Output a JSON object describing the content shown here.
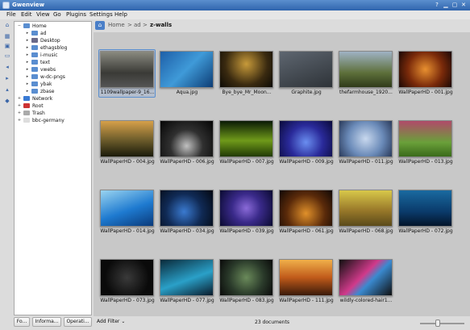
{
  "window": {
    "title": "Gwenview",
    "buttons": [
      "?",
      "▁",
      "▢",
      "✕"
    ]
  },
  "menu": [
    "File",
    "Edit",
    "View",
    "Go",
    "Plugins",
    "Settings",
    "Help"
  ],
  "sidebar_tools": [
    "home-icon",
    "grid-icon",
    "image-icon",
    "folder-icon",
    "back-icon",
    "forward-icon",
    "up-icon",
    "tag-icon"
  ],
  "tree": [
    {
      "label": "Home",
      "depth": 0,
      "expander": "−",
      "icon": "#5a8ed0"
    },
    {
      "label": "ad",
      "depth": 1,
      "expander": "▸",
      "icon": "#5a8ed0"
    },
    {
      "label": "Desktop",
      "depth": 1,
      "expander": "▸",
      "icon": "#6a6a8a"
    },
    {
      "label": "ethagsblog",
      "depth": 1,
      "expander": "▸",
      "icon": "#5a8ed0"
    },
    {
      "label": "i-music",
      "depth": 1,
      "expander": "▸",
      "icon": "#5a8ed0"
    },
    {
      "label": "text",
      "depth": 1,
      "expander": "▸",
      "icon": "#5a8ed0"
    },
    {
      "label": "vwebs",
      "depth": 1,
      "expander": "▸",
      "icon": "#5a8ed0"
    },
    {
      "label": "w-dc-pngs",
      "depth": 1,
      "expander": "▸",
      "icon": "#5a8ed0"
    },
    {
      "label": "ybak",
      "depth": 1,
      "expander": "▸",
      "icon": "#5a8ed0"
    },
    {
      "label": "zbase",
      "depth": 1,
      "expander": "▸",
      "icon": "#5a8ed0"
    },
    {
      "label": "Network",
      "depth": 0,
      "expander": "+",
      "icon": "#3a7bd5"
    },
    {
      "label": "Root",
      "depth": 0,
      "expander": "+",
      "icon": "#c33"
    },
    {
      "label": "Trash",
      "depth": 0,
      "expander": "+",
      "icon": "#aaa"
    },
    {
      "label": "bbc-germany",
      "depth": 0,
      "expander": "+",
      "icon": "#ddd"
    }
  ],
  "panel_buttons": [
    "Fo...",
    "Informa...",
    "Operati..."
  ],
  "breadcrumb": {
    "home_icon": "⌂",
    "parts": [
      "Home",
      ">",
      "ad",
      ">",
      "z-walls"
    ]
  },
  "thumbnails": [
    {
      "name": "1109wallpaper-9_16...",
      "g": "linear-gradient(180deg,#8a8a80,#3a3a36 60%,#555)",
      "selected": true
    },
    {
      "name": "Aqua.jpg",
      "g": "linear-gradient(135deg,#1e5fa8,#3f9ad8 50%,#0d3d75)"
    },
    {
      "name": "Bye_bye_Mr_Moon...",
      "g": "radial-gradient(circle at 50% 35%,#c79a3a,#3a2a10 60%,#0c0a05)"
    },
    {
      "name": "Graphite.jpg",
      "g": "linear-gradient(160deg,#5e6670,#2e3338)"
    },
    {
      "name": "thefarmhouse_1920...",
      "g": "linear-gradient(180deg,#9fb2c4,#5d6f3a 60%,#2f3a1a)"
    },
    {
      "name": "WallPaperHD - 001.jpg",
      "g": "radial-gradient(circle,#e89030,#7a2a0a 55%,#1a0805)"
    },
    {
      "name": "WallPaperHD - 004.jpg",
      "g": "linear-gradient(180deg,#d7a04a,#6a5a2a 55%,#1a1a0a)"
    },
    {
      "name": "WallPaperHD - 006.jpg",
      "g": "radial-gradient(circle at 50% 70%,#c0c0c0,#303030 45%,#050505)"
    },
    {
      "name": "WallPaperHD - 007.jpg",
      "g": "linear-gradient(180deg,#0a1a05,#6f9a1a 55%,#213a05)"
    },
    {
      "name": "WallPaperHD - 009.jpg",
      "g": "radial-gradient(circle at 50% 60%,#6a8ef0,#2a2a9a 50%,#0a0a3a)"
    },
    {
      "name": "WallPaperHD - 011.jpg",
      "g": "radial-gradient(circle,#c8d8ee,#6a8ab8 55%,#2a3a5a)"
    },
    {
      "name": "WallPaperHD - 013.jpg",
      "g": "linear-gradient(180deg,#b04a6a,#6aa03a 60%,#3a6a1a)"
    },
    {
      "name": "WallPaperHD - 014.jpg",
      "g": "linear-gradient(160deg,#9ad4f0,#1e7ad0 55%,#0a3a7a)"
    },
    {
      "name": "WallPaperHD - 034.jpg",
      "g": "radial-gradient(circle at 45% 60%,#3a7ad0,#102a55 50%,#030810)"
    },
    {
      "name": "WallPaperHD - 039.jpg",
      "g": "radial-gradient(circle,#8a6ad8,#3a2a8a 45%,#0a0a30)"
    },
    {
      "name": "WallPaperHD - 061.jpg",
      "g": "radial-gradient(circle at 50% 65%,#e0902a,#5a2a0a 55%,#100805)"
    },
    {
      "name": "WallPaperHD - 068.jpg",
      "g": "linear-gradient(180deg,#d8c84a,#9a7a2a 55%,#5a4a1a)"
    },
    {
      "name": "WallPaperHD - 072.jpg",
      "g": "linear-gradient(180deg,#1a6aa0,#0a3a6a 60%,#03152a)"
    },
    {
      "name": "WallPaperHD - 073.jpg",
      "g": "radial-gradient(circle,#3a3a3a,#0a0a0a 70%)"
    },
    {
      "name": "WallPaperHD - 077.jpg",
      "g": "linear-gradient(160deg,#0a2a3a,#2aa0c8 55%,#0a1a2a)"
    },
    {
      "name": "WallPaperHD - 083.jpg",
      "g": "radial-gradient(circle,#6a8a5a,#2a3a2a 55%,#0a0a0a)"
    },
    {
      "name": "WallPaperHD - 111.jpg",
      "g": "linear-gradient(180deg,#f0b04a,#c05a1a 50%,#3a1a0a)"
    },
    {
      "name": "wildly-colored-hair1...",
      "g": "linear-gradient(135deg,#101010,#d03a8a 45%,#3a8ad0 60%,#101010)"
    }
  ],
  "status": {
    "filter": "Add Filter",
    "filter_arrow": "⌄",
    "count": "23 documents",
    "zoom": 0.4
  }
}
